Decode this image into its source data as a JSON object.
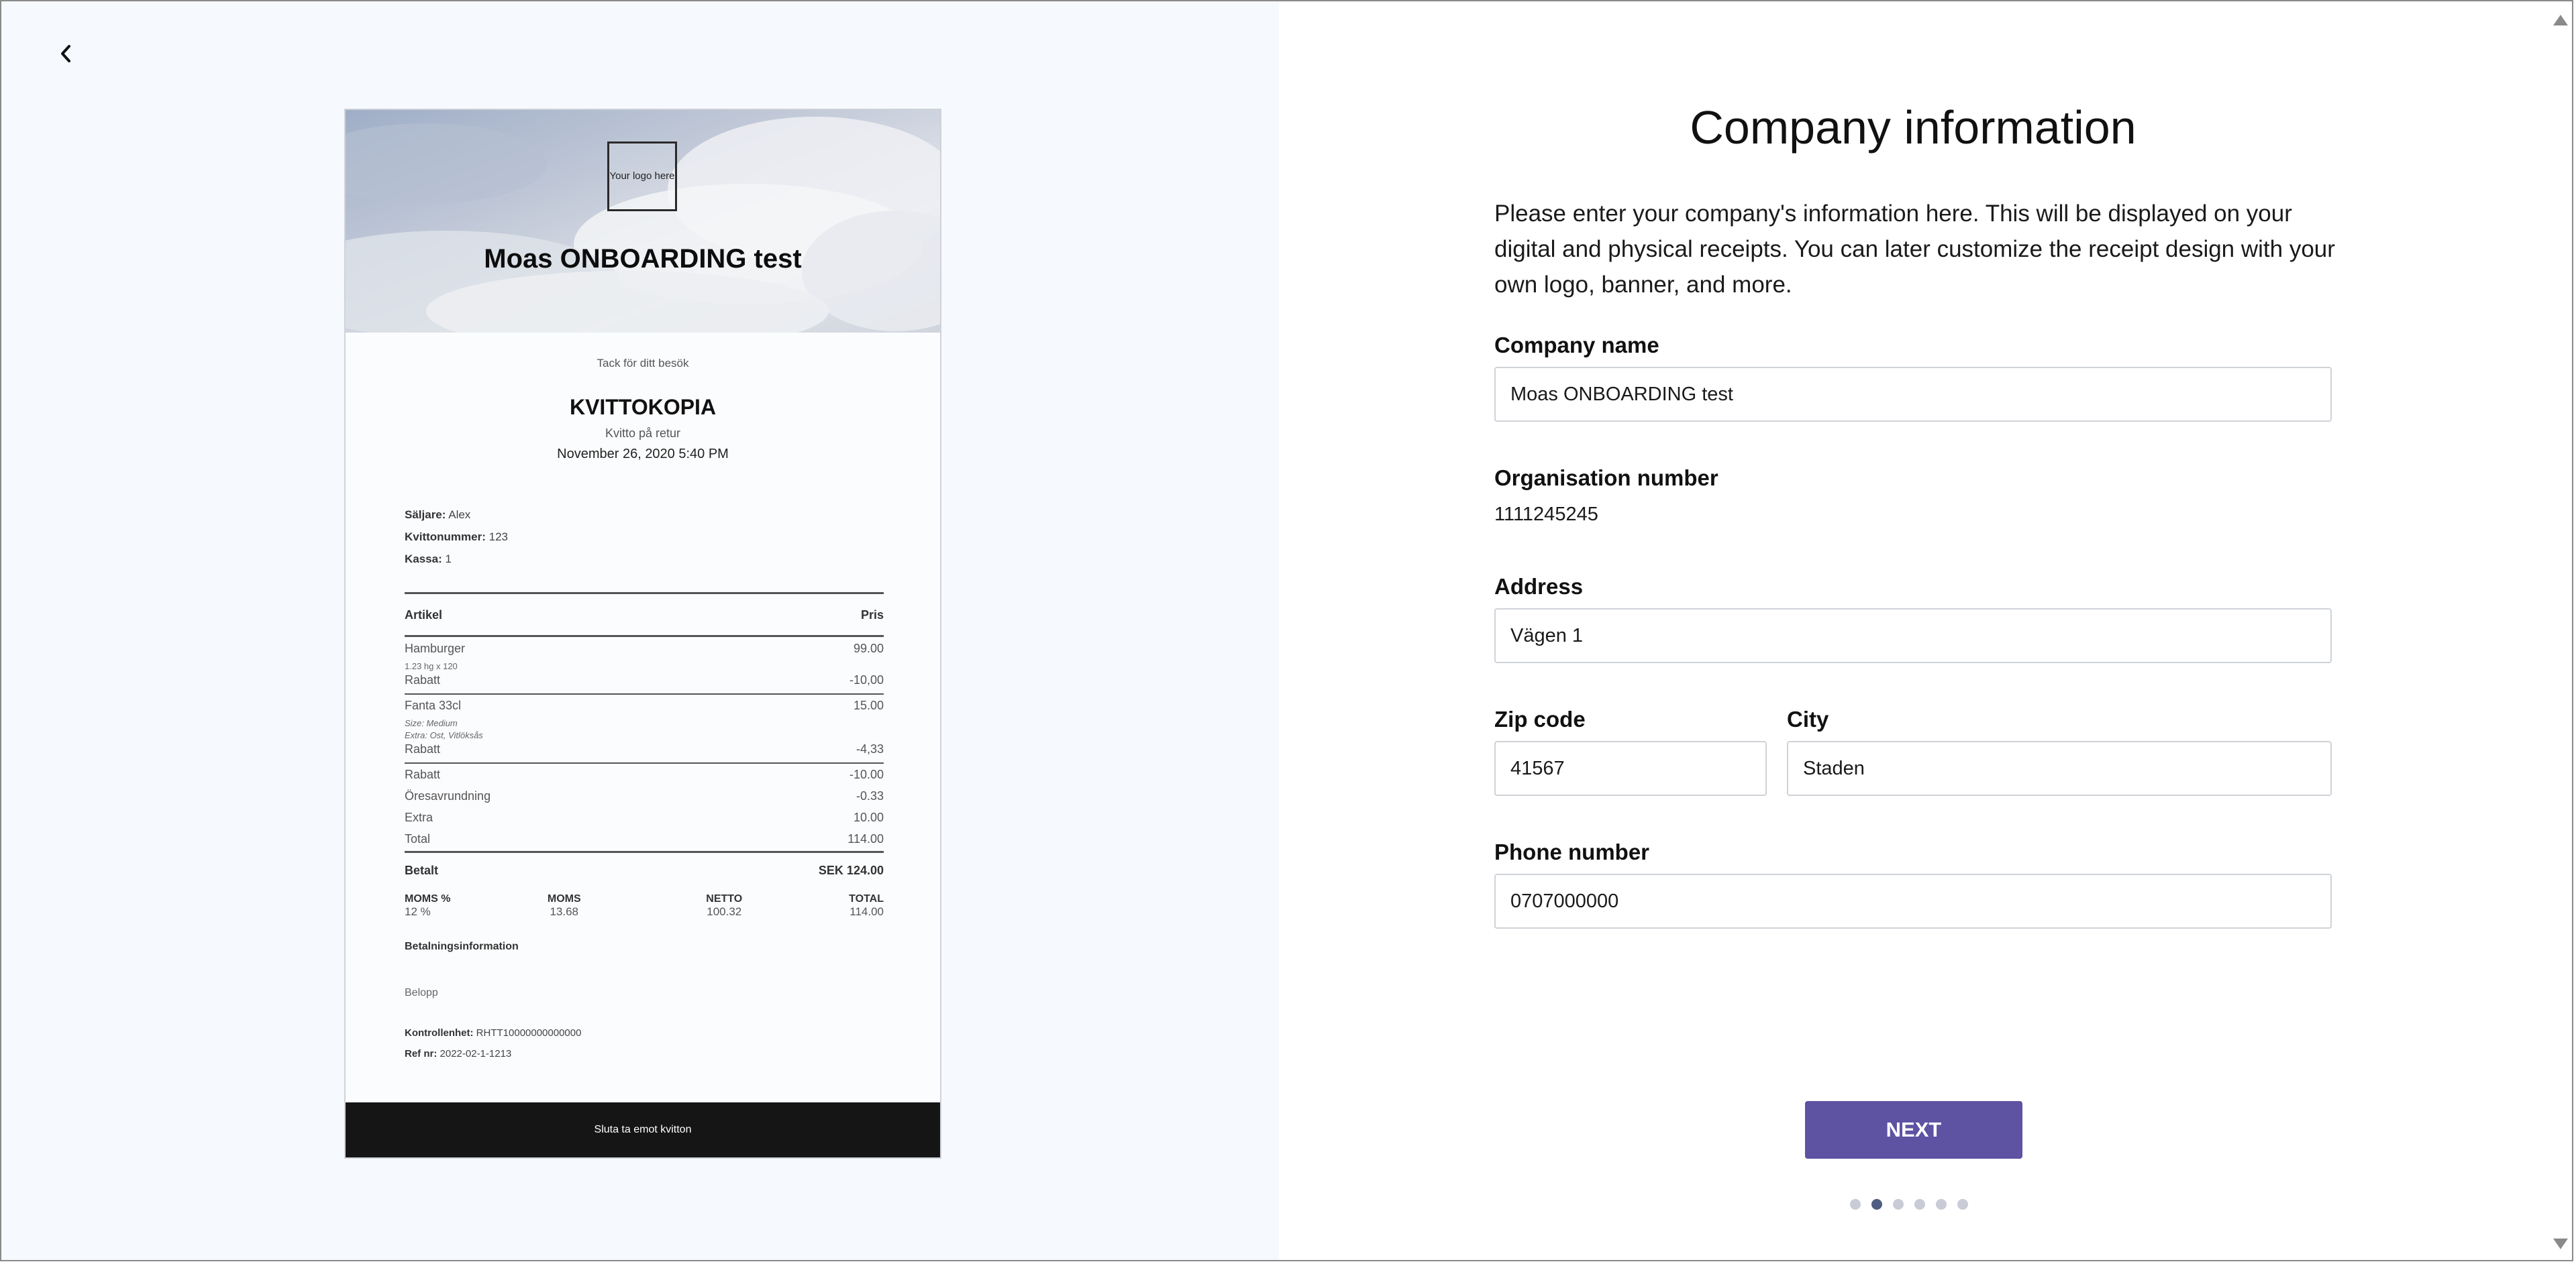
{
  "receipt": {
    "logo_text": "Your logo here",
    "store_name": "Moas ONBOARDING test",
    "thanks": "Tack för ditt besök",
    "heading": "KVITTOKOPIA",
    "subheading": "Kvitto på retur",
    "date": "November 26, 2020 5:40 PM",
    "seller_label": "Säljare:",
    "seller_value": "Alex",
    "receipt_no_label": "Kvittonummer:",
    "receipt_no_value": "123",
    "register_label": "Kassa:",
    "register_value": "1",
    "col_item": "Artikel",
    "col_price": "Pris",
    "items": [
      {
        "name": "Hamburger",
        "price": "99.00"
      },
      {
        "name": "1.23 hg x 120",
        "price": ""
      },
      {
        "name": "Rabatt",
        "price": "-10,00"
      },
      {
        "name": "Fanta 33cl",
        "price": "15.00"
      },
      {
        "name": "Size: Medium",
        "price": ""
      },
      {
        "name": "Extra: Ost, Vitlöksås",
        "price": ""
      },
      {
        "name": "Rabatt",
        "price": "-4,33"
      },
      {
        "name": "Rabatt",
        "price": "-10.00"
      },
      {
        "name": "Öresavrundning",
        "price": "-0.33"
      },
      {
        "name": "Extra",
        "price": "10.00"
      },
      {
        "name": "Total",
        "price": "114.00"
      }
    ],
    "paid_label": "Betalt",
    "paid_value": "SEK 124.00",
    "vat_headers": [
      "MOMS %",
      "MOMS",
      "NETTO",
      "TOTAL"
    ],
    "vat_values": [
      "12 %",
      "13.68",
      "100.32",
      "114.00"
    ],
    "payment_info": "Betalningsinformation",
    "amount_label": "Belopp",
    "control_label": "Kontrollenhet:",
    "control_value": "RHTT10000000000000",
    "ref_label": "Ref nr:",
    "ref_value": "2022-02-1-1213",
    "footer": "Sluta ta emot kvitton"
  },
  "form": {
    "title": "Company information",
    "intro": "Please enter your company's information here. This will be displayed on your digital and physical receipts. You can later customize the receipt design with your own logo, banner, and more.",
    "company_name_label": "Company name",
    "company_name_value": "Moas ONBOARDING test",
    "org_number_label": "Organisation number",
    "org_number_value": "1111245245",
    "address_label": "Address",
    "address_value": "Vägen 1",
    "zip_label": "Zip code",
    "zip_value": "41567",
    "city_label": "City",
    "city_value": "Staden",
    "phone_label": "Phone number",
    "phone_value": "0707000000",
    "next_label": "NEXT"
  },
  "progress": {
    "total_steps": 6,
    "current_step": 2
  },
  "colors": {
    "accent": "#5e52a3",
    "dot_active": "#4f5d80",
    "dot_inactive": "#c9cbd6"
  },
  "icons": {
    "back": "chevron-left-icon",
    "scroll_up": "scroll-up-arrow",
    "scroll_down": "scroll-down-arrow"
  }
}
